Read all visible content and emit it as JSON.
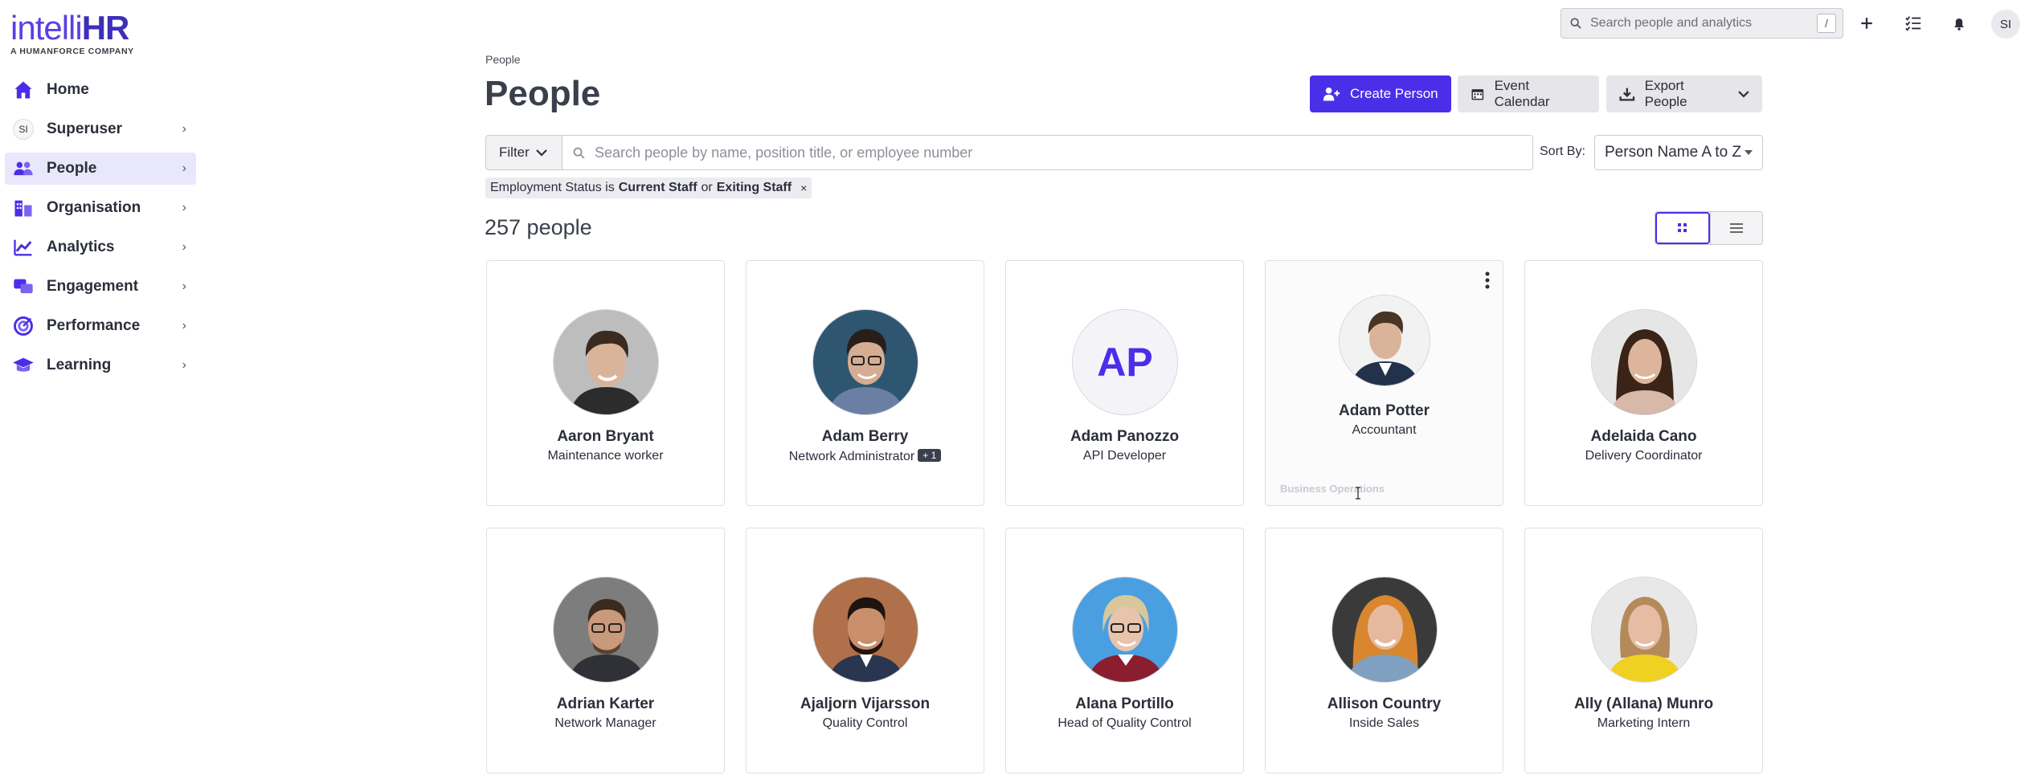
{
  "app": {
    "logo_main": "intelli",
    "logo_bold": "HR",
    "logo_sub_pre": "A ",
    "logo_sub_bold": "HUMANFORCE",
    "logo_sub_post": " COMPANY"
  },
  "sidebar": {
    "items": [
      {
        "label": "Home",
        "icon": "home-icon"
      },
      {
        "label": "Superuser",
        "icon": "user-initials-badge",
        "badge": "SI"
      },
      {
        "label": "People",
        "icon": "people-icon",
        "active": true
      },
      {
        "label": "Organisation",
        "icon": "organisation-icon"
      },
      {
        "label": "Analytics",
        "icon": "analytics-icon"
      },
      {
        "label": "Engagement",
        "icon": "engagement-icon"
      },
      {
        "label": "Performance",
        "icon": "performance-icon"
      },
      {
        "label": "Learning",
        "icon": "learning-icon"
      }
    ]
  },
  "topbar": {
    "search_placeholder": "Search people and analytics",
    "shortcut": "/",
    "avatar": "SI"
  },
  "header": {
    "breadcrumb": "People",
    "title": "People",
    "create_label": "Create Person",
    "event_label": "Event Calendar",
    "export_label": "Export People"
  },
  "filters": {
    "filter_label": "Filter",
    "search_placeholder": "Search people by name, position title, or employee number",
    "sort_label": "Sort By:",
    "sort_value": "Person Name A to Z",
    "chip": {
      "prefix": "Employment Status is",
      "value1": "Current Staff",
      "joiner": "or",
      "value2": "Exiting Staff",
      "remove": "×"
    }
  },
  "results": {
    "count": "257 people"
  },
  "people": [
    {
      "name": "Aaron Bryant",
      "role": "Maintenance worker"
    },
    {
      "name": "Adam Berry",
      "role": "Network Administrator",
      "extra": "+ 1"
    },
    {
      "name": "Adam Panozzo",
      "role": "API Developer",
      "initials": "AP"
    },
    {
      "name": "Adam Potter",
      "role": "Accountant",
      "dept": "Business Operations"
    },
    {
      "name": "Adelaida Cano",
      "role": "Delivery Coordinator"
    },
    {
      "name": "Adrian Karter",
      "role": "Network Manager"
    },
    {
      "name": "Ajaljorn Vijarsson",
      "role": "Quality Control"
    },
    {
      "name": "Alana Portillo",
      "role": "Head of Quality Control"
    },
    {
      "name": "Allison Country",
      "role": "Inside Sales"
    },
    {
      "name": "Ally (Allana) Munro",
      "role": "Marketing Intern"
    }
  ],
  "colors": {
    "accent": "#4b2ee8",
    "active_nav_bg": "#e9e7fb"
  }
}
